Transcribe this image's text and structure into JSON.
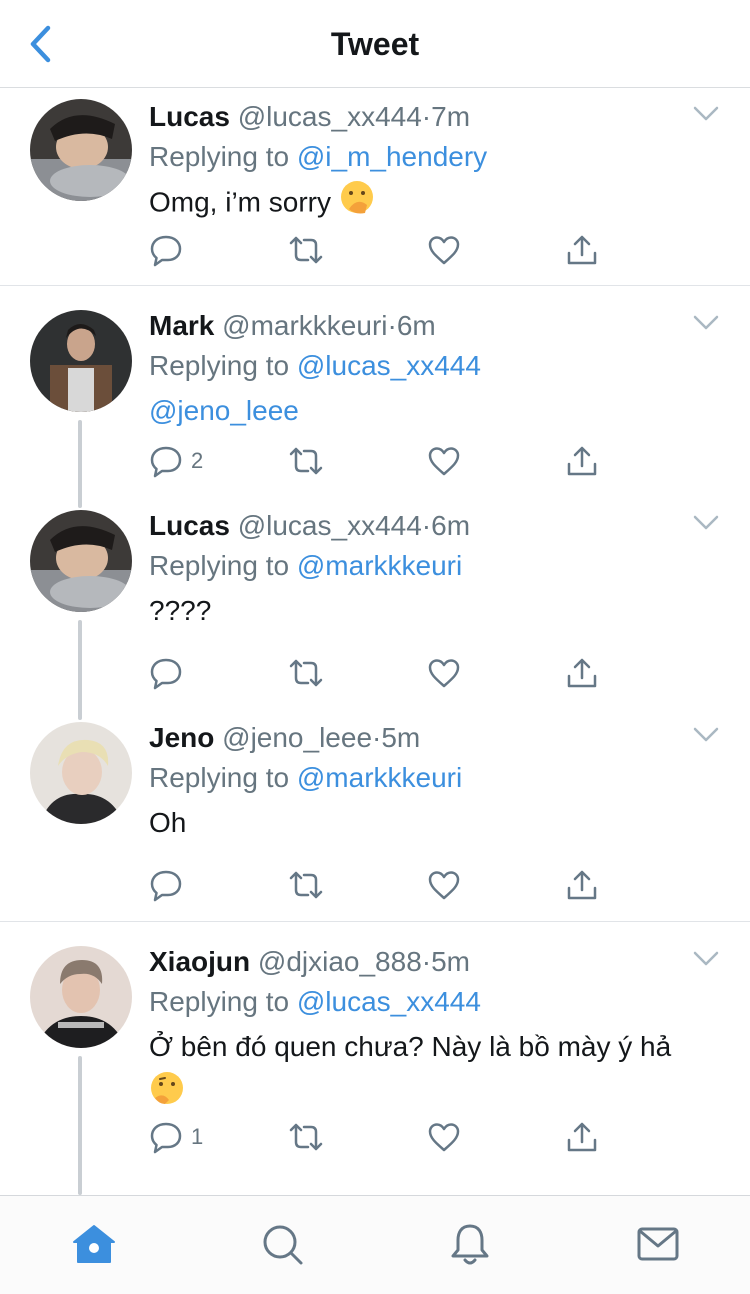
{
  "header": {
    "title": "Tweet"
  },
  "tweets": [
    {
      "name": "Lucas",
      "handle": "@lucas_xx444",
      "dot": "·",
      "time": "7m",
      "reply_prefix": "Replying to",
      "reply_to": "@i_m_hendery",
      "text": "Omg, i’m sorry",
      "emoji": "shushing-face",
      "reply_count": ""
    },
    {
      "name": "Mark",
      "handle": "@markkkeuri",
      "dot": "·",
      "time": "6m",
      "reply_prefix": "Replying to",
      "reply_to": "@lucas_xx444",
      "text": "@jeno_leee",
      "reply_count": "2"
    },
    {
      "name": "Lucas",
      "handle": "@lucas_xx444",
      "dot": "·",
      "time": "6m",
      "reply_prefix": "Replying to",
      "reply_to": "@markkkeuri",
      "text": "????",
      "reply_count": ""
    },
    {
      "name": "Jeno",
      "handle": "@jeno_leee",
      "dot": "·",
      "time": "5m",
      "reply_prefix": "Replying to",
      "reply_to": "@markkkeuri",
      "text": "Oh",
      "reply_count": ""
    },
    {
      "name": "Xiaojun",
      "handle": "@djxiao_888",
      "dot": "·",
      "time": "5m",
      "reply_prefix": "Replying to",
      "reply_to": "@lucas_xx444",
      "text": "Ở bên đó quen chưa? Này là bồ mày ý hả",
      "emoji": "thinking-face",
      "reply_count": "1"
    }
  ],
  "tabbar": {
    "items": [
      "home-icon",
      "search-icon",
      "notifications-icon",
      "messages-icon"
    ],
    "active": "home-icon"
  },
  "colors": {
    "accent": "#3c8fde",
    "secondary_text": "#66757f",
    "thread_line": "#c9ced3"
  }
}
